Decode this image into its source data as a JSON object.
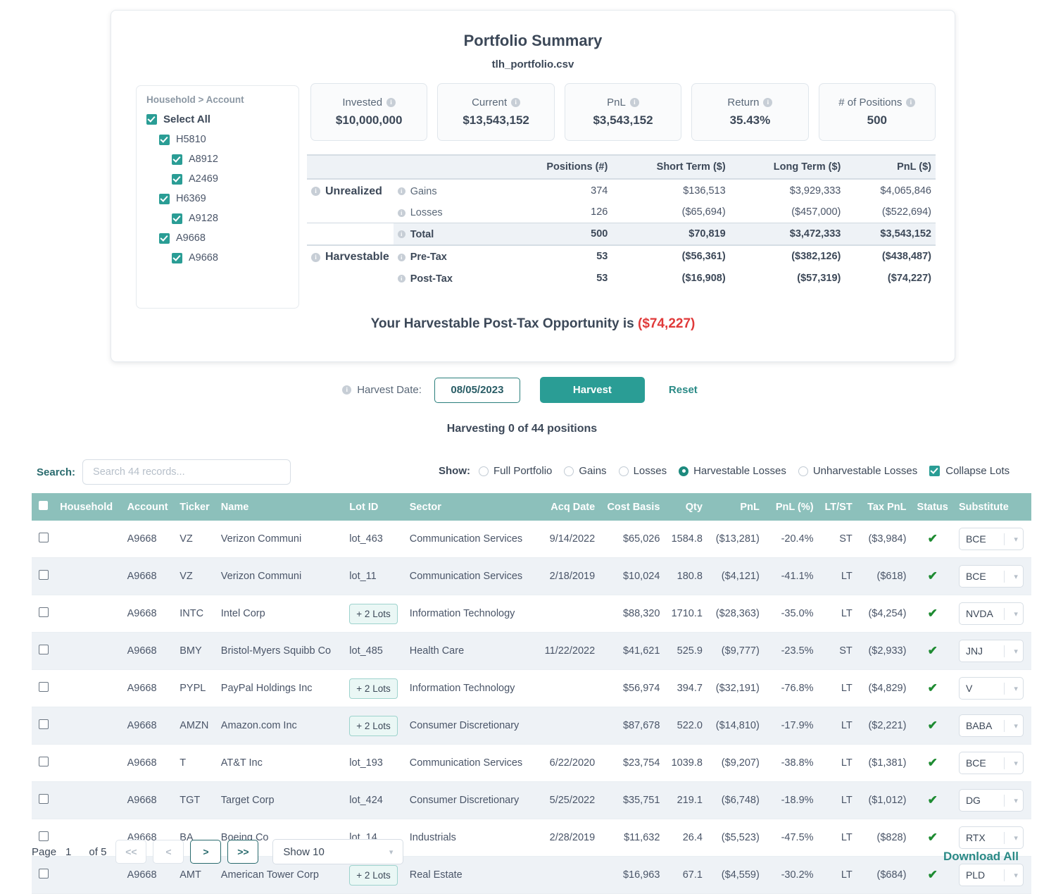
{
  "summary": {
    "title": "Portfolio Summary",
    "subtitle": "tlh_portfolio.csv",
    "tree": {
      "header": "Household > Account",
      "items": [
        {
          "label": "Select All",
          "level": 0,
          "checked": true
        },
        {
          "label": "H5810",
          "level": 1,
          "checked": true
        },
        {
          "label": "A8912",
          "level": 2,
          "checked": true
        },
        {
          "label": "A2469",
          "level": 2,
          "checked": true
        },
        {
          "label": "H6369",
          "level": 1,
          "checked": true
        },
        {
          "label": "A9128",
          "level": 2,
          "checked": true
        },
        {
          "label": "A9668",
          "level": 1,
          "checked": true
        },
        {
          "label": "A9668",
          "level": 2,
          "checked": true
        }
      ]
    },
    "kpis": [
      {
        "label": "Invested",
        "value": "$10,000,000"
      },
      {
        "label": "Current",
        "value": "$13,543,152"
      },
      {
        "label": "PnL",
        "value": "$3,543,152"
      },
      {
        "label": "Return",
        "value": "35.43%"
      },
      {
        "label": "# of Positions",
        "value": "500"
      }
    ],
    "table": {
      "columns": [
        "",
        "",
        "Positions (#)",
        "Short Term ($)",
        "Long Term ($)",
        "PnL ($)"
      ],
      "groups": [
        {
          "name": "Unrealized",
          "rows": [
            {
              "label": "Gains",
              "positions": "374",
              "short_term": "$136,513",
              "long_term": "$3,929,333",
              "pnl": "$4,065,846",
              "neg": false,
              "bold": false
            },
            {
              "label": "Losses",
              "positions": "126",
              "short_term": "($65,694)",
              "long_term": "($457,000)",
              "pnl": "($522,694)",
              "neg": true,
              "bold": false
            },
            {
              "label": "Total",
              "positions": "500",
              "short_term": "$70,819",
              "long_term": "$3,472,333",
              "pnl": "$3,543,152",
              "neg": false,
              "bold": true
            }
          ]
        },
        {
          "name": "Harvestable",
          "rows": [
            {
              "label": "Pre-Tax",
              "positions": "53",
              "short_term": "($56,361)",
              "long_term": "($382,126)",
              "pnl": "($438,487)",
              "neg": true,
              "bold": true
            },
            {
              "label": "Post-Tax",
              "positions": "53",
              "short_term": "($16,908)",
              "long_term": "($57,319)",
              "pnl": "($74,227)",
              "neg": true,
              "bold": true
            }
          ]
        }
      ]
    },
    "opportunity_text": "Your Harvestable Post-Tax Opportunity is",
    "opportunity_value": "($74,227)"
  },
  "harvest": {
    "date_label": "Harvest Date:",
    "date_value": "08/05/2023",
    "harvest_button": "Harvest",
    "reset_button": "Reset",
    "status": "Harvesting 0 of 44 positions"
  },
  "controls": {
    "search_label": "Search:",
    "search_value": "",
    "search_placeholder": "Search 44 records...",
    "show_label": "Show:",
    "radios": [
      {
        "label": "Full Portfolio",
        "selected": false
      },
      {
        "label": "Gains",
        "selected": false
      },
      {
        "label": "Losses",
        "selected": false
      },
      {
        "label": "Harvestable Losses",
        "selected": true
      },
      {
        "label": "Unharvestable Losses",
        "selected": false
      }
    ],
    "collapse_lots": {
      "label": "Collapse Lots",
      "checked": true
    }
  },
  "table": {
    "columns": [
      "Household",
      "Account",
      "Ticker",
      "Name",
      "Lot ID",
      "Sector",
      "Acq Date",
      "Cost Basis",
      "Qty",
      "PnL",
      "PnL (%)",
      "LT/ST",
      "Tax PnL",
      "Status",
      "Substitute"
    ],
    "rows": [
      {
        "household": "",
        "account": "A9668",
        "ticker": "VZ",
        "name": "Verizon Communi",
        "lot_id": "lot_463",
        "lots_badge": false,
        "sector": "Communication Services",
        "acq_date": "9/14/2022",
        "cost_basis": "$65,026",
        "qty": "1584.8",
        "pnl": "($13,281)",
        "pnl_pct": "-20.4%",
        "ltst": "ST",
        "tax_pnl": "($3,984)",
        "status": "ok",
        "substitute": "BCE"
      },
      {
        "household": "",
        "account": "A9668",
        "ticker": "VZ",
        "name": "Verizon Communi",
        "lot_id": "lot_11",
        "lots_badge": false,
        "sector": "Communication Services",
        "acq_date": "2/18/2019",
        "cost_basis": "$10,024",
        "qty": "180.8",
        "pnl": "($4,121)",
        "pnl_pct": "-41.1%",
        "ltst": "LT",
        "tax_pnl": "($618)",
        "status": "ok",
        "substitute": "BCE"
      },
      {
        "household": "",
        "account": "A9668",
        "ticker": "INTC",
        "name": "Intel Corp",
        "lot_id": "+ 2 Lots",
        "lots_badge": true,
        "sector": "Information Technology",
        "acq_date": "",
        "cost_basis": "$88,320",
        "qty": "1710.1",
        "pnl": "($28,363)",
        "pnl_pct": "-35.0%",
        "ltst": "LT",
        "tax_pnl": "($4,254)",
        "status": "ok",
        "substitute": "NVDA"
      },
      {
        "household": "",
        "account": "A9668",
        "ticker": "BMY",
        "name": "Bristol-Myers Squibb Co",
        "lot_id": "lot_485",
        "lots_badge": false,
        "sector": "Health Care",
        "acq_date": "11/22/2022",
        "cost_basis": "$41,621",
        "qty": "525.9",
        "pnl": "($9,777)",
        "pnl_pct": "-23.5%",
        "ltst": "ST",
        "tax_pnl": "($2,933)",
        "status": "ok",
        "substitute": "JNJ"
      },
      {
        "household": "",
        "account": "A9668",
        "ticker": "PYPL",
        "name": "PayPal Holdings Inc",
        "lot_id": "+ 2 Lots",
        "lots_badge": true,
        "sector": "Information Technology",
        "acq_date": "",
        "cost_basis": "$56,974",
        "qty": "394.7",
        "pnl": "($32,191)",
        "pnl_pct": "-76.8%",
        "ltst": "LT",
        "tax_pnl": "($4,829)",
        "status": "ok",
        "substitute": "V"
      },
      {
        "household": "",
        "account": "A9668",
        "ticker": "AMZN",
        "name": "Amazon.com Inc",
        "lot_id": "+ 2 Lots",
        "lots_badge": true,
        "sector": "Consumer Discretionary",
        "acq_date": "",
        "cost_basis": "$87,678",
        "qty": "522.0",
        "pnl": "($14,810)",
        "pnl_pct": "-17.9%",
        "ltst": "LT",
        "tax_pnl": "($2,221)",
        "status": "ok",
        "substitute": "BABA"
      },
      {
        "household": "",
        "account": "A9668",
        "ticker": "T",
        "name": "AT&T Inc",
        "lot_id": "lot_193",
        "lots_badge": false,
        "sector": "Communication Services",
        "acq_date": "6/22/2020",
        "cost_basis": "$23,754",
        "qty": "1039.8",
        "pnl": "($9,207)",
        "pnl_pct": "-38.8%",
        "ltst": "LT",
        "tax_pnl": "($1,381)",
        "status": "ok",
        "substitute": "BCE"
      },
      {
        "household": "",
        "account": "A9668",
        "ticker": "TGT",
        "name": "Target Corp",
        "lot_id": "lot_424",
        "lots_badge": false,
        "sector": "Consumer Discretionary",
        "acq_date": "5/25/2022",
        "cost_basis": "$35,751",
        "qty": "219.1",
        "pnl": "($6,748)",
        "pnl_pct": "-18.9%",
        "ltst": "LT",
        "tax_pnl": "($1,012)",
        "status": "ok",
        "substitute": "DG"
      },
      {
        "household": "",
        "account": "A9668",
        "ticker": "BA",
        "name": "Boeing Co",
        "lot_id": "lot_14",
        "lots_badge": false,
        "sector": "Industrials",
        "acq_date": "2/28/2019",
        "cost_basis": "$11,632",
        "qty": "26.4",
        "pnl": "($5,523)",
        "pnl_pct": "-47.5%",
        "ltst": "LT",
        "tax_pnl": "($828)",
        "status": "ok",
        "substitute": "RTX"
      },
      {
        "household": "",
        "account": "A9668",
        "ticker": "AMT",
        "name": "American Tower Corp",
        "lot_id": "+ 2 Lots",
        "lots_badge": true,
        "sector": "Real Estate",
        "acq_date": "",
        "cost_basis": "$16,963",
        "qty": "67.1",
        "pnl": "($4,559)",
        "pnl_pct": "-30.2%",
        "ltst": "LT",
        "tax_pnl": "($684)",
        "status": "ok",
        "substitute": "PLD"
      }
    ]
  },
  "footer": {
    "page_label": "Page",
    "page_number": "1",
    "of_label": "of 5",
    "first_button": "<<",
    "prev_button": "<",
    "next_button": ">",
    "last_button": ">>",
    "page_size": "Show 10",
    "download_all": "Download All"
  },
  "colors": {
    "accent": "#2a9d95",
    "table_header": "#8cc0bb",
    "negative": "#e03a3a",
    "positive_check": "#1e8b32",
    "link": "#2a8a86"
  }
}
